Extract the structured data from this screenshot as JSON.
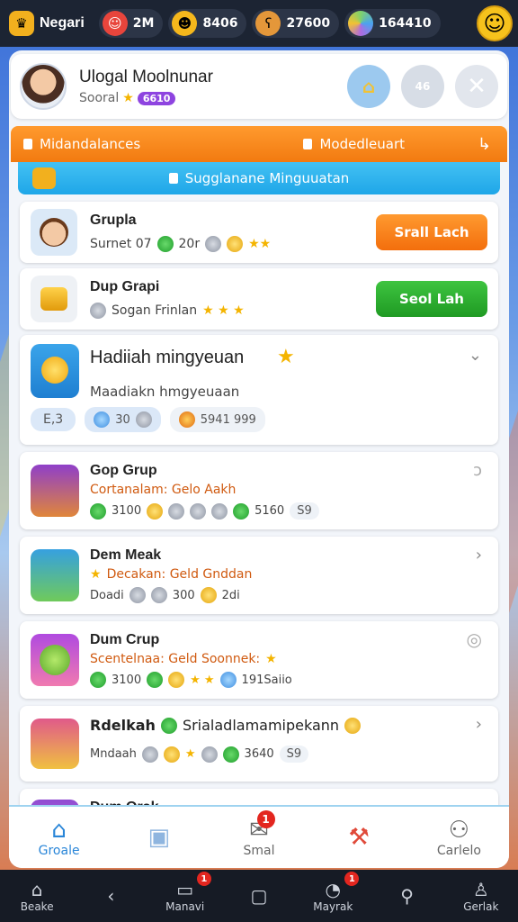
{
  "topbar": {
    "resources": [
      {
        "icon": "crown-icon",
        "value": "Negari"
      },
      {
        "icon": "avatar-icon",
        "value": "2M"
      },
      {
        "icon": "coin-face-icon",
        "value": "8406"
      },
      {
        "icon": "bear-icon",
        "value": "27600"
      },
      {
        "icon": "gem-icon",
        "value": "164410"
      }
    ],
    "profile_icon": "smile-face-icon"
  },
  "profile": {
    "name": "Ulogal Moolnunar",
    "subtitle": "Sooral",
    "level": "6610",
    "btn1_label": "",
    "btn2_label": "46"
  },
  "tabs": {
    "left": "Midandalances",
    "right": "Modedleuart"
  },
  "banner": {
    "label": "Sugglanane Minguuatan"
  },
  "cards": [
    {
      "title": "Grupla",
      "sub": "Surnet 07",
      "sub2": "20r",
      "button": "Srall Lach"
    },
    {
      "title": "Dup Grapi",
      "sub": "Sogan Frinlan",
      "button": "Seol Lah"
    },
    {
      "title": "Hadiiah mingyeuan",
      "sub": "Maadiakn hmgyeuaan",
      "chip1": "E,3",
      "chip2": "30",
      "chip3": "5941 999"
    },
    {
      "title": "Gop Grup",
      "sub": "Cortanalam: Gelo Aakh",
      "stats": [
        "3100",
        "5160",
        "S9"
      ]
    },
    {
      "title": "Dem Meak",
      "sub": "Decakan: Geld Gnddan",
      "stats": [
        "Doadi",
        "300",
        "2di"
      ]
    },
    {
      "title": "Dum Crup",
      "sub": "Scentelnaa: Geld Soonnek:",
      "stats": [
        "3100",
        "191Saiio"
      ]
    },
    {
      "title": "Rdelkah",
      "title_suffix": "Srialadlamamipekann",
      "sub": "Mndaah",
      "stats": [
        "3640",
        "S9"
      ]
    },
    {
      "title": "Dum Orak"
    }
  ],
  "bottom_nav": [
    {
      "label": "Groale",
      "icon": "home-icon"
    },
    {
      "label": "",
      "icon": "box-icon"
    },
    {
      "label": "Smal",
      "icon": "mail-icon",
      "badge": "1"
    },
    {
      "label": "",
      "icon": "hammer-icon"
    },
    {
      "label": "Carlelo",
      "icon": "people-icon"
    }
  ],
  "system_nav": [
    {
      "label": "Beake",
      "icon": "home-outline-icon"
    },
    {
      "label": "",
      "icon": "back-icon"
    },
    {
      "label": "Manavi",
      "icon": "chat-icon",
      "badge": "1"
    },
    {
      "label": "",
      "icon": "bag-icon"
    },
    {
      "label": "Mayrak",
      "icon": "bell-icon",
      "badge": "1"
    },
    {
      "label": "",
      "icon": "search-icon"
    },
    {
      "label": "Gerlak",
      "icon": "person-icon"
    }
  ]
}
